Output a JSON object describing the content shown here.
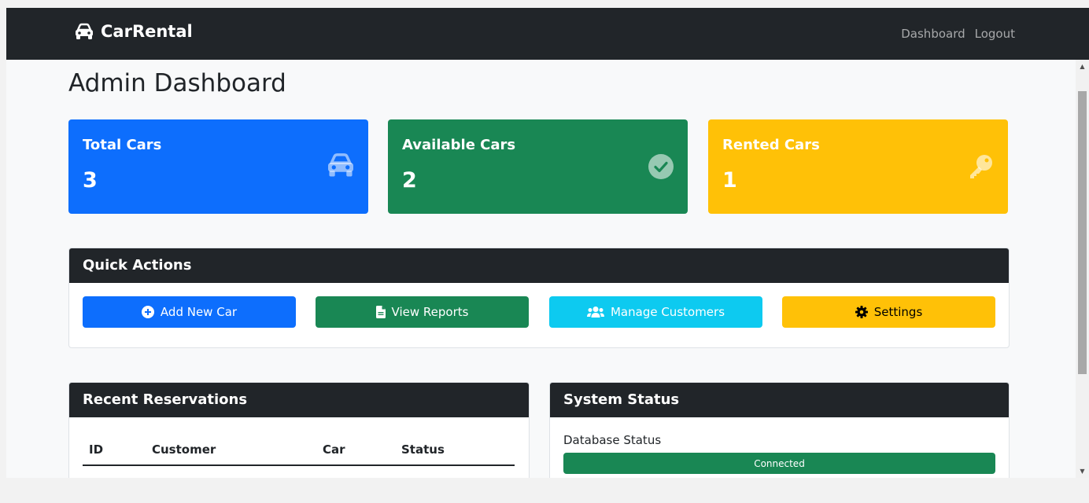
{
  "navbar": {
    "brand": "CarRental",
    "links": [
      "Dashboard",
      "Logout"
    ]
  },
  "page": {
    "title": "Admin Dashboard"
  },
  "stats": [
    {
      "label": "Total Cars",
      "value": "3",
      "color": "#0d6efd",
      "icon": "car-icon"
    },
    {
      "label": "Available Cars",
      "value": "2",
      "color": "#198754",
      "icon": "check-circle-icon"
    },
    {
      "label": "Rented Cars",
      "value": "1",
      "color": "#ffc107",
      "icon": "key-icon"
    }
  ],
  "quick_actions": {
    "title": "Quick Actions",
    "buttons": [
      {
        "label": "Add New Car",
        "icon": "plus-circle-icon",
        "color": "#0d6efd"
      },
      {
        "label": "View Reports",
        "icon": "file-icon",
        "color": "#198754"
      },
      {
        "label": "Manage Customers",
        "icon": "users-icon",
        "color": "#0dcaf0"
      },
      {
        "label": "Settings",
        "icon": "gear-icon",
        "color": "#ffc107"
      }
    ]
  },
  "reservations": {
    "title": "Recent Reservations",
    "columns": [
      "ID",
      "Customer",
      "Car",
      "Status"
    ]
  },
  "system_status": {
    "title": "System Status",
    "database_label": "Database Status",
    "database_value": "Connected",
    "database_progress": 1.0
  }
}
